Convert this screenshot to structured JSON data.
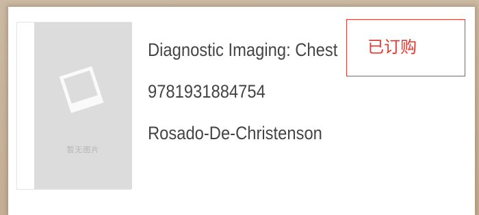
{
  "book": {
    "title": "Diagnostic Imaging: Chest",
    "isbn": "9781931884754",
    "author": "Rosado-De-Christenson",
    "cover_placeholder_text": "暂无图片"
  },
  "status": {
    "label": "已订购",
    "color": "#e8372f"
  },
  "colors": {
    "frame": "#c8b49c",
    "placeholder_bg": "#dcdcdc",
    "text": "#444444"
  },
  "icons": {
    "cover_placeholder": "photo-placeholder-icon"
  }
}
